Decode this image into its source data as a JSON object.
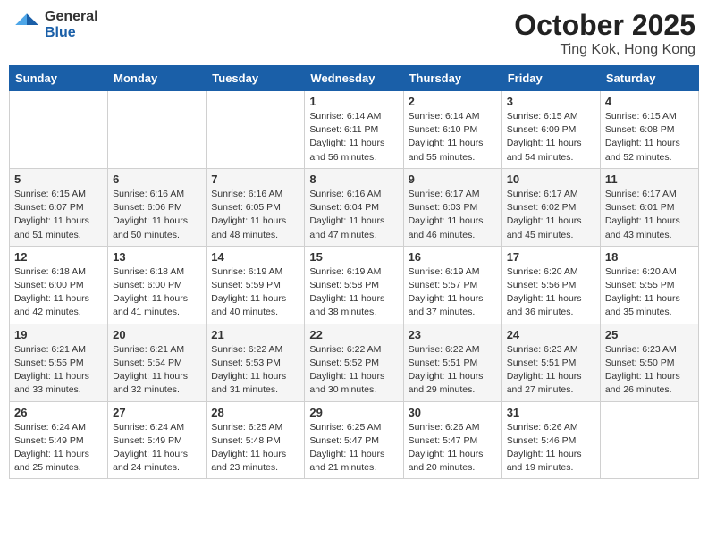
{
  "header": {
    "logo_general": "General",
    "logo_blue": "Blue",
    "title": "October 2025",
    "subtitle": "Ting Kok, Hong Kong"
  },
  "weekdays": [
    "Sunday",
    "Monday",
    "Tuesday",
    "Wednesday",
    "Thursday",
    "Friday",
    "Saturday"
  ],
  "weeks": [
    [
      {
        "day": "",
        "sunrise": "",
        "sunset": "",
        "daylight": ""
      },
      {
        "day": "",
        "sunrise": "",
        "sunset": "",
        "daylight": ""
      },
      {
        "day": "",
        "sunrise": "",
        "sunset": "",
        "daylight": ""
      },
      {
        "day": "1",
        "sunrise": "Sunrise: 6:14 AM",
        "sunset": "Sunset: 6:11 PM",
        "daylight": "Daylight: 11 hours and 56 minutes."
      },
      {
        "day": "2",
        "sunrise": "Sunrise: 6:14 AM",
        "sunset": "Sunset: 6:10 PM",
        "daylight": "Daylight: 11 hours and 55 minutes."
      },
      {
        "day": "3",
        "sunrise": "Sunrise: 6:15 AM",
        "sunset": "Sunset: 6:09 PM",
        "daylight": "Daylight: 11 hours and 54 minutes."
      },
      {
        "day": "4",
        "sunrise": "Sunrise: 6:15 AM",
        "sunset": "Sunset: 6:08 PM",
        "daylight": "Daylight: 11 hours and 52 minutes."
      }
    ],
    [
      {
        "day": "5",
        "sunrise": "Sunrise: 6:15 AM",
        "sunset": "Sunset: 6:07 PM",
        "daylight": "Daylight: 11 hours and 51 minutes."
      },
      {
        "day": "6",
        "sunrise": "Sunrise: 6:16 AM",
        "sunset": "Sunset: 6:06 PM",
        "daylight": "Daylight: 11 hours and 50 minutes."
      },
      {
        "day": "7",
        "sunrise": "Sunrise: 6:16 AM",
        "sunset": "Sunset: 6:05 PM",
        "daylight": "Daylight: 11 hours and 48 minutes."
      },
      {
        "day": "8",
        "sunrise": "Sunrise: 6:16 AM",
        "sunset": "Sunset: 6:04 PM",
        "daylight": "Daylight: 11 hours and 47 minutes."
      },
      {
        "day": "9",
        "sunrise": "Sunrise: 6:17 AM",
        "sunset": "Sunset: 6:03 PM",
        "daylight": "Daylight: 11 hours and 46 minutes."
      },
      {
        "day": "10",
        "sunrise": "Sunrise: 6:17 AM",
        "sunset": "Sunset: 6:02 PM",
        "daylight": "Daylight: 11 hours and 45 minutes."
      },
      {
        "day": "11",
        "sunrise": "Sunrise: 6:17 AM",
        "sunset": "Sunset: 6:01 PM",
        "daylight": "Daylight: 11 hours and 43 minutes."
      }
    ],
    [
      {
        "day": "12",
        "sunrise": "Sunrise: 6:18 AM",
        "sunset": "Sunset: 6:00 PM",
        "daylight": "Daylight: 11 hours and 42 minutes."
      },
      {
        "day": "13",
        "sunrise": "Sunrise: 6:18 AM",
        "sunset": "Sunset: 6:00 PM",
        "daylight": "Daylight: 11 hours and 41 minutes."
      },
      {
        "day": "14",
        "sunrise": "Sunrise: 6:19 AM",
        "sunset": "Sunset: 5:59 PM",
        "daylight": "Daylight: 11 hours and 40 minutes."
      },
      {
        "day": "15",
        "sunrise": "Sunrise: 6:19 AM",
        "sunset": "Sunset: 5:58 PM",
        "daylight": "Daylight: 11 hours and 38 minutes."
      },
      {
        "day": "16",
        "sunrise": "Sunrise: 6:19 AM",
        "sunset": "Sunset: 5:57 PM",
        "daylight": "Daylight: 11 hours and 37 minutes."
      },
      {
        "day": "17",
        "sunrise": "Sunrise: 6:20 AM",
        "sunset": "Sunset: 5:56 PM",
        "daylight": "Daylight: 11 hours and 36 minutes."
      },
      {
        "day": "18",
        "sunrise": "Sunrise: 6:20 AM",
        "sunset": "Sunset: 5:55 PM",
        "daylight": "Daylight: 11 hours and 35 minutes."
      }
    ],
    [
      {
        "day": "19",
        "sunrise": "Sunrise: 6:21 AM",
        "sunset": "Sunset: 5:55 PM",
        "daylight": "Daylight: 11 hours and 33 minutes."
      },
      {
        "day": "20",
        "sunrise": "Sunrise: 6:21 AM",
        "sunset": "Sunset: 5:54 PM",
        "daylight": "Daylight: 11 hours and 32 minutes."
      },
      {
        "day": "21",
        "sunrise": "Sunrise: 6:22 AM",
        "sunset": "Sunset: 5:53 PM",
        "daylight": "Daylight: 11 hours and 31 minutes."
      },
      {
        "day": "22",
        "sunrise": "Sunrise: 6:22 AM",
        "sunset": "Sunset: 5:52 PM",
        "daylight": "Daylight: 11 hours and 30 minutes."
      },
      {
        "day": "23",
        "sunrise": "Sunrise: 6:22 AM",
        "sunset": "Sunset: 5:51 PM",
        "daylight": "Daylight: 11 hours and 29 minutes."
      },
      {
        "day": "24",
        "sunrise": "Sunrise: 6:23 AM",
        "sunset": "Sunset: 5:51 PM",
        "daylight": "Daylight: 11 hours and 27 minutes."
      },
      {
        "day": "25",
        "sunrise": "Sunrise: 6:23 AM",
        "sunset": "Sunset: 5:50 PM",
        "daylight": "Daylight: 11 hours and 26 minutes."
      }
    ],
    [
      {
        "day": "26",
        "sunrise": "Sunrise: 6:24 AM",
        "sunset": "Sunset: 5:49 PM",
        "daylight": "Daylight: 11 hours and 25 minutes."
      },
      {
        "day": "27",
        "sunrise": "Sunrise: 6:24 AM",
        "sunset": "Sunset: 5:49 PM",
        "daylight": "Daylight: 11 hours and 24 minutes."
      },
      {
        "day": "28",
        "sunrise": "Sunrise: 6:25 AM",
        "sunset": "Sunset: 5:48 PM",
        "daylight": "Daylight: 11 hours and 23 minutes."
      },
      {
        "day": "29",
        "sunrise": "Sunrise: 6:25 AM",
        "sunset": "Sunset: 5:47 PM",
        "daylight": "Daylight: 11 hours and 21 minutes."
      },
      {
        "day": "30",
        "sunrise": "Sunrise: 6:26 AM",
        "sunset": "Sunset: 5:47 PM",
        "daylight": "Daylight: 11 hours and 20 minutes."
      },
      {
        "day": "31",
        "sunrise": "Sunrise: 6:26 AM",
        "sunset": "Sunset: 5:46 PM",
        "daylight": "Daylight: 11 hours and 19 minutes."
      },
      {
        "day": "",
        "sunrise": "",
        "sunset": "",
        "daylight": ""
      }
    ]
  ]
}
